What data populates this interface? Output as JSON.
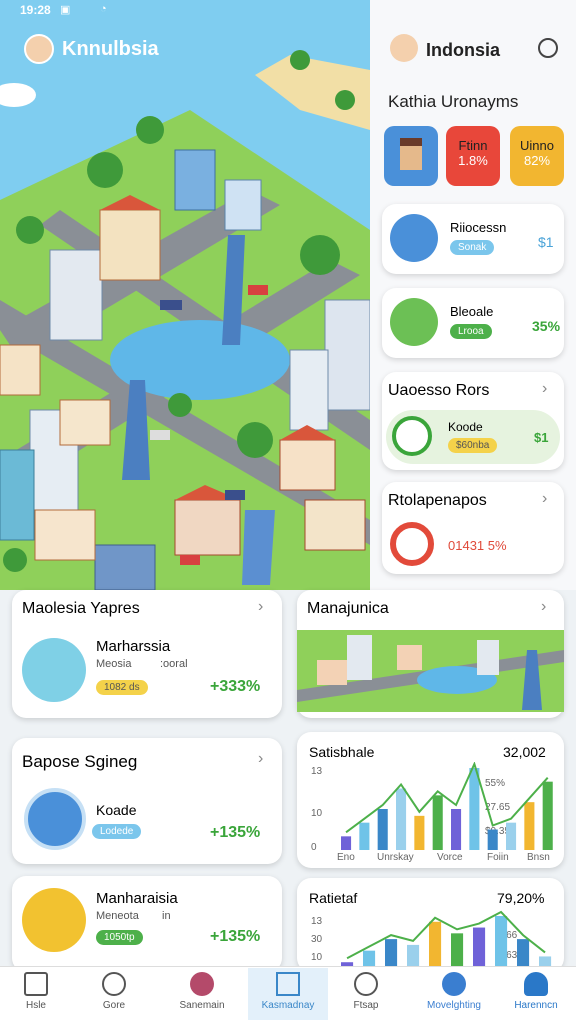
{
  "status_bar": {
    "time": "19:28"
  },
  "left_header": {
    "title": "Knnulbsia"
  },
  "right_header": {
    "title": "Indonsia"
  },
  "right_panel": {
    "section_title": "Kathia Uronayms",
    "tiles": [
      {
        "label": "",
        "value": "",
        "color": "#4a90d9"
      },
      {
        "label": "Ftinn",
        "value": "1.8%",
        "color": "#e8473a"
      },
      {
        "label": "Uinno",
        "value": "82%",
        "color": "#f2b630"
      }
    ],
    "items": [
      {
        "title": "Riiocessn",
        "badge": "Sonak",
        "value": "$1"
      },
      {
        "title": "Bleoale",
        "badge": "Lrooa",
        "value": "35%"
      }
    ],
    "card3": {
      "title": "Uaoesso Rors",
      "item_title": "Koode",
      "badge": "$60nba",
      "value": "$1"
    },
    "card4": {
      "title": "Rtolapenapos",
      "value": "01431 5%"
    }
  },
  "cards": [
    {
      "title": "Maolesia Yapres",
      "item_title": "Marharssia",
      "subtitle": "Meosia",
      "sub2": ":ooral",
      "badge": "1082 ds",
      "value": "+333%"
    },
    {
      "title": "Manajunica"
    },
    {
      "title": "Bapose Sgineg",
      "item_title": "Koade",
      "badge": "Lodede",
      "value": "+135%"
    },
    {
      "title": "Satisbhale",
      "value": "32,002",
      "yticks": [
        "13",
        "10",
        "0"
      ],
      "ylabels": [
        "55%",
        "27.65",
        "$0.35"
      ],
      "xlabels": [
        "Eno",
        "Unrskay",
        "Vorce",
        "Foiin",
        "Bnsn"
      ]
    },
    {
      "title": "Manharaisia",
      "subtitle": "Meneota",
      "sub2": "in",
      "badge": "1050tp",
      "value": "+135%"
    },
    {
      "title": "Ratietaf",
      "value": "79,20%",
      "yticks": [
        "13",
        "30",
        "10"
      ],
      "ylabels": [
        "$766",
        "$763"
      ]
    }
  ],
  "chart_data": [
    {
      "type": "bar",
      "title": "Satisbhale",
      "values": [
        2,
        4,
        6,
        9,
        5,
        8,
        6,
        12,
        3,
        4,
        7,
        10
      ]
    },
    {
      "type": "bar",
      "title": "Ratietaf",
      "values": [
        1,
        3,
        5,
        4,
        8,
        6,
        7,
        9,
        5,
        2
      ]
    }
  ],
  "nav": [
    {
      "label": "Hsle"
    },
    {
      "label": "Gore"
    },
    {
      "label": "Sanemain"
    },
    {
      "label": "Kasmadnay"
    },
    {
      "label": "Ftsap"
    },
    {
      "label": "Movelghting"
    },
    {
      "label": "Harenncn"
    }
  ]
}
